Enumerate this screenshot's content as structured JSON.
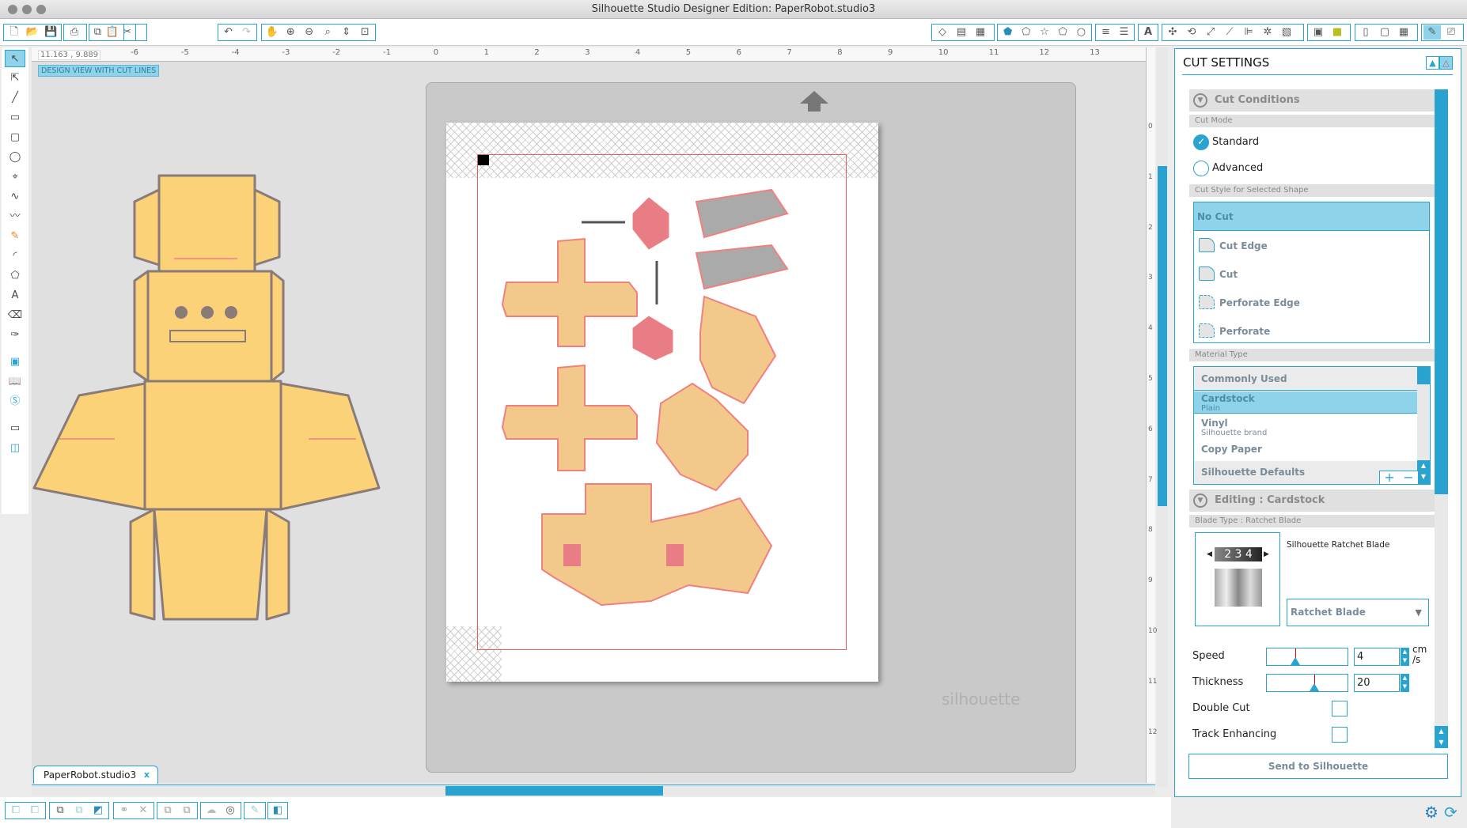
{
  "window": {
    "title": "Silhouette Studio Designer Edition: PaperRobot.studio3"
  },
  "toolbar": {
    "groups": [
      [
        "new-document",
        "open",
        "new-blank",
        "save",
        "save-to-sd"
      ],
      [
        "print",
        "print-cut"
      ],
      [
        "copy",
        "paste",
        "cut"
      ],
      [
        "undo",
        "redo"
      ],
      [
        "pan",
        "zoom-in",
        "zoom-out",
        "zoom-select",
        "drag-zoom",
        "fit-to-page"
      ]
    ],
    "right_icons": [
      "page-setup",
      "cut-settings",
      "grid",
      "fill",
      "line",
      "shadow",
      "offset",
      "trace",
      "align",
      "line-style",
      "text",
      "replicate",
      "rotate",
      "scale",
      "knife",
      "transform",
      "modify",
      "image-effects",
      "cut-studio",
      "library",
      "store",
      "send",
      "settings"
    ]
  },
  "left_tools": [
    "select",
    "point-edit",
    "line",
    "rectangle",
    "rounded-rectangle",
    "ellipse",
    "polygon",
    "bezier",
    "freehand",
    "smooth-freehand",
    "arc",
    "regular-polygon",
    "text",
    "eraser",
    "knife",
    "fill-panel",
    "library",
    "store",
    "design-view",
    "split-view"
  ],
  "canvas": {
    "coords": "11.163 , 9.889",
    "view_label": "DESIGN VIEW WITH CUT LINES",
    "ruler_top": [
      "-6",
      "-5",
      "-4",
      "-3",
      "-2",
      "-1",
      "0",
      "1",
      "2",
      "3",
      "4",
      "5",
      "6",
      "7",
      "8",
      "9",
      "10",
      "11",
      "12",
      "13"
    ],
    "ruler_side": [
      "0",
      "1",
      "2",
      "3",
      "4",
      "5",
      "6",
      "7",
      "8",
      "9",
      "10",
      "11",
      "12"
    ],
    "watermark": "silhouette",
    "tab": {
      "label": "PaperRobot.studio3",
      "close": "x"
    }
  },
  "bottom_toolbar": {
    "groups": [
      [
        "group",
        "ungroup"
      ],
      [
        "make-compound",
        "release-compound",
        "select-all"
      ],
      [
        "weld",
        "delete"
      ],
      [
        "bring-forward",
        "send-backward"
      ],
      [
        "offset",
        "registration"
      ],
      [
        "sketch"
      ],
      [
        "layers"
      ]
    ]
  },
  "cut_settings": {
    "title": "CUT SETTINGS",
    "cut_conditions": {
      "header": "Cut Conditions",
      "cut_mode_label": "Cut Mode",
      "modes": [
        {
          "label": "Standard",
          "selected": true
        },
        {
          "label": "Advanced",
          "selected": false
        }
      ],
      "cut_style_label": "Cut Style for Selected Shape",
      "styles": [
        {
          "label": "No Cut",
          "selected": true
        },
        {
          "label": "Cut Edge",
          "selected": false
        },
        {
          "label": "Cut",
          "selected": false
        },
        {
          "label": "Perforate Edge",
          "selected": false
        },
        {
          "label": "Perforate",
          "selected": false
        }
      ],
      "material_type_label": "Material Type",
      "materials": [
        {
          "label": "Commonly Used",
          "sub": ""
        },
        {
          "label": "Cardstock",
          "sub": "Plain",
          "selected": true
        },
        {
          "label": "Vinyl",
          "sub": "Silhouette brand"
        },
        {
          "label": "Copy Paper",
          "sub": ""
        },
        {
          "label": "Silhouette Defaults",
          "sub": ""
        }
      ],
      "add": "+",
      "remove": "−"
    },
    "editing": {
      "header": "Editing : Cardstock",
      "blade_type_label": "Blade Type : Ratchet Blade",
      "blade_name": "Silhouette Ratchet Blade",
      "blade_digits": "2 3 4",
      "blade_select": "Ratchet Blade",
      "speed": {
        "label": "Speed",
        "value": "4",
        "unit": "cm /s",
        "fraction": 0.35
      },
      "thickness": {
        "label": "Thickness",
        "value": "20",
        "fraction": 0.59
      },
      "double_cut": {
        "label": "Double Cut",
        "checked": false
      },
      "track_enhancing": {
        "label": "Track Enhancing",
        "checked": false
      }
    },
    "send_button": "Send to Silhouette"
  },
  "colors": {
    "accent": "#2aa3cf",
    "selection": "#8fd3ea",
    "design_fill": "#fbd277",
    "paper_piece": "#f2c98a",
    "cut_line": "#f08080"
  }
}
